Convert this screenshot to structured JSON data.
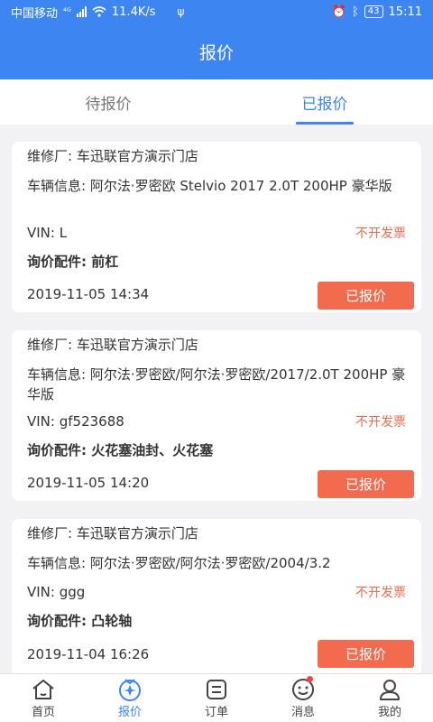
{
  "status": {
    "carrier": "中国移动",
    "net_type": "⁴ᴳ",
    "speed": "11.4K/s",
    "battery": "43",
    "time": "15:11"
  },
  "title": "报价",
  "tabs": [
    {
      "label": "待报价"
    },
    {
      "label": "已报价"
    }
  ],
  "cards": [
    {
      "shop": "维修厂: 车迅联官方演示门店",
      "vehicle": "车辆信息: 阿尔法·罗密欧 Stelvio 2017 2.0T 200HP 豪华版",
      "vin": "VIN: L",
      "invoice": "不开发票",
      "parts": "询价配件: 前杠",
      "date": "2019-11-05 14:34",
      "button": "已报价"
    },
    {
      "shop": "维修厂: 车迅联官方演示门店",
      "vehicle": "车辆信息: 阿尔法·罗密欧/阿尔法·罗密欧/2017/2.0T 200HP 豪华版",
      "vin": "VIN: gf523688",
      "invoice": "不开发票",
      "parts": "询价配件: 火花塞油封、火花塞",
      "date": "2019-11-05 14:20",
      "button": "已报价"
    },
    {
      "shop": "维修厂: 车迅联官方演示门店",
      "vehicle": "车辆信息: 阿尔法·罗密欧/阿尔法·罗密欧/2004/3.2",
      "vin": "VIN: ggg",
      "invoice": "不开发票",
      "parts": "询价配件: 凸轮轴",
      "date": "2019-11-04 16:26",
      "button": "已报价"
    }
  ],
  "nav": [
    {
      "label": "首页",
      "icon": "home-icon"
    },
    {
      "label": "报价",
      "icon": "quote-icon"
    },
    {
      "label": "订单",
      "icon": "order-icon"
    },
    {
      "label": "消息",
      "icon": "message-icon"
    },
    {
      "label": "我的",
      "icon": "profile-icon"
    }
  ],
  "colors": {
    "primary": "#3d86f2",
    "accent": "#f26b4f",
    "link": "#2a5ba8"
  }
}
